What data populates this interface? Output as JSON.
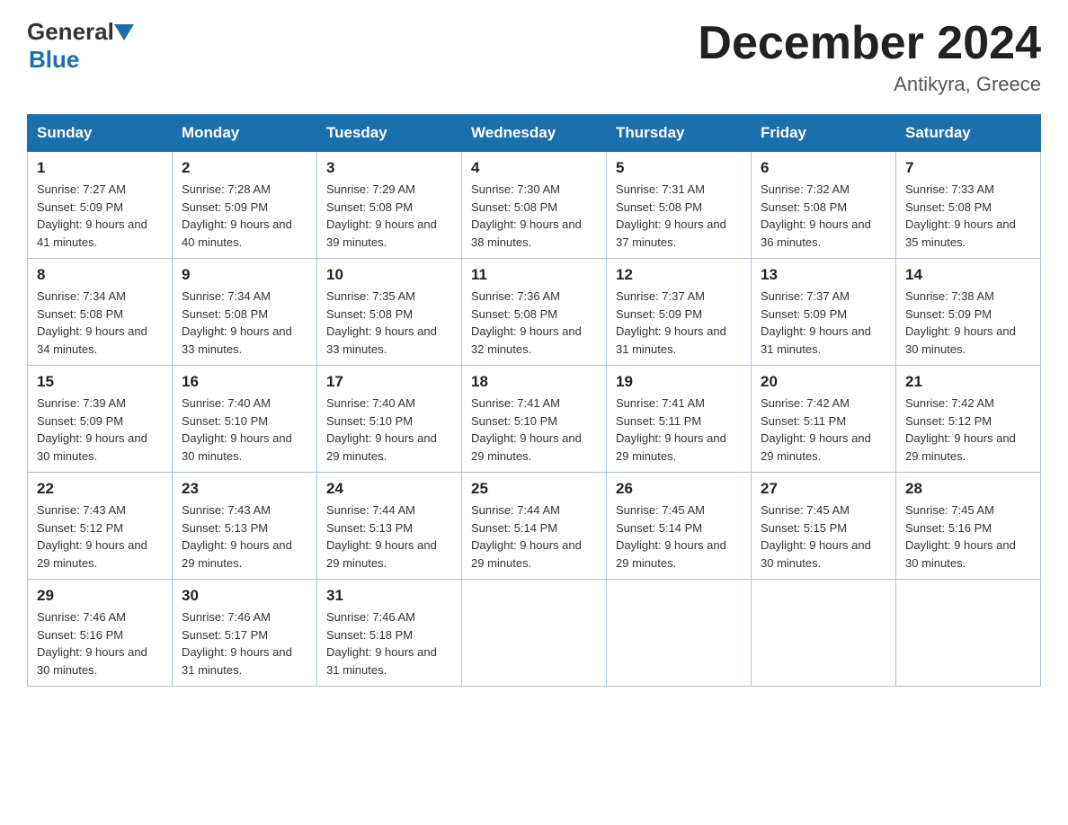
{
  "header": {
    "logo_general": "General",
    "logo_blue": "Blue",
    "month_title": "December 2024",
    "location": "Antikyra, Greece"
  },
  "days_of_week": [
    "Sunday",
    "Monday",
    "Tuesday",
    "Wednesday",
    "Thursday",
    "Friday",
    "Saturday"
  ],
  "weeks": [
    [
      {
        "day": "1",
        "sunrise": "Sunrise: 7:27 AM",
        "sunset": "Sunset: 5:09 PM",
        "daylight": "Daylight: 9 hours and 41 minutes."
      },
      {
        "day": "2",
        "sunrise": "Sunrise: 7:28 AM",
        "sunset": "Sunset: 5:09 PM",
        "daylight": "Daylight: 9 hours and 40 minutes."
      },
      {
        "day": "3",
        "sunrise": "Sunrise: 7:29 AM",
        "sunset": "Sunset: 5:08 PM",
        "daylight": "Daylight: 9 hours and 39 minutes."
      },
      {
        "day": "4",
        "sunrise": "Sunrise: 7:30 AM",
        "sunset": "Sunset: 5:08 PM",
        "daylight": "Daylight: 9 hours and 38 minutes."
      },
      {
        "day": "5",
        "sunrise": "Sunrise: 7:31 AM",
        "sunset": "Sunset: 5:08 PM",
        "daylight": "Daylight: 9 hours and 37 minutes."
      },
      {
        "day": "6",
        "sunrise": "Sunrise: 7:32 AM",
        "sunset": "Sunset: 5:08 PM",
        "daylight": "Daylight: 9 hours and 36 minutes."
      },
      {
        "day": "7",
        "sunrise": "Sunrise: 7:33 AM",
        "sunset": "Sunset: 5:08 PM",
        "daylight": "Daylight: 9 hours and 35 minutes."
      }
    ],
    [
      {
        "day": "8",
        "sunrise": "Sunrise: 7:34 AM",
        "sunset": "Sunset: 5:08 PM",
        "daylight": "Daylight: 9 hours and 34 minutes."
      },
      {
        "day": "9",
        "sunrise": "Sunrise: 7:34 AM",
        "sunset": "Sunset: 5:08 PM",
        "daylight": "Daylight: 9 hours and 33 minutes."
      },
      {
        "day": "10",
        "sunrise": "Sunrise: 7:35 AM",
        "sunset": "Sunset: 5:08 PM",
        "daylight": "Daylight: 9 hours and 33 minutes."
      },
      {
        "day": "11",
        "sunrise": "Sunrise: 7:36 AM",
        "sunset": "Sunset: 5:08 PM",
        "daylight": "Daylight: 9 hours and 32 minutes."
      },
      {
        "day": "12",
        "sunrise": "Sunrise: 7:37 AM",
        "sunset": "Sunset: 5:09 PM",
        "daylight": "Daylight: 9 hours and 31 minutes."
      },
      {
        "day": "13",
        "sunrise": "Sunrise: 7:37 AM",
        "sunset": "Sunset: 5:09 PM",
        "daylight": "Daylight: 9 hours and 31 minutes."
      },
      {
        "day": "14",
        "sunrise": "Sunrise: 7:38 AM",
        "sunset": "Sunset: 5:09 PM",
        "daylight": "Daylight: 9 hours and 30 minutes."
      }
    ],
    [
      {
        "day": "15",
        "sunrise": "Sunrise: 7:39 AM",
        "sunset": "Sunset: 5:09 PM",
        "daylight": "Daylight: 9 hours and 30 minutes."
      },
      {
        "day": "16",
        "sunrise": "Sunrise: 7:40 AM",
        "sunset": "Sunset: 5:10 PM",
        "daylight": "Daylight: 9 hours and 30 minutes."
      },
      {
        "day": "17",
        "sunrise": "Sunrise: 7:40 AM",
        "sunset": "Sunset: 5:10 PM",
        "daylight": "Daylight: 9 hours and 29 minutes."
      },
      {
        "day": "18",
        "sunrise": "Sunrise: 7:41 AM",
        "sunset": "Sunset: 5:10 PM",
        "daylight": "Daylight: 9 hours and 29 minutes."
      },
      {
        "day": "19",
        "sunrise": "Sunrise: 7:41 AM",
        "sunset": "Sunset: 5:11 PM",
        "daylight": "Daylight: 9 hours and 29 minutes."
      },
      {
        "day": "20",
        "sunrise": "Sunrise: 7:42 AM",
        "sunset": "Sunset: 5:11 PM",
        "daylight": "Daylight: 9 hours and 29 minutes."
      },
      {
        "day": "21",
        "sunrise": "Sunrise: 7:42 AM",
        "sunset": "Sunset: 5:12 PM",
        "daylight": "Daylight: 9 hours and 29 minutes."
      }
    ],
    [
      {
        "day": "22",
        "sunrise": "Sunrise: 7:43 AM",
        "sunset": "Sunset: 5:12 PM",
        "daylight": "Daylight: 9 hours and 29 minutes."
      },
      {
        "day": "23",
        "sunrise": "Sunrise: 7:43 AM",
        "sunset": "Sunset: 5:13 PM",
        "daylight": "Daylight: 9 hours and 29 minutes."
      },
      {
        "day": "24",
        "sunrise": "Sunrise: 7:44 AM",
        "sunset": "Sunset: 5:13 PM",
        "daylight": "Daylight: 9 hours and 29 minutes."
      },
      {
        "day": "25",
        "sunrise": "Sunrise: 7:44 AM",
        "sunset": "Sunset: 5:14 PM",
        "daylight": "Daylight: 9 hours and 29 minutes."
      },
      {
        "day": "26",
        "sunrise": "Sunrise: 7:45 AM",
        "sunset": "Sunset: 5:14 PM",
        "daylight": "Daylight: 9 hours and 29 minutes."
      },
      {
        "day": "27",
        "sunrise": "Sunrise: 7:45 AM",
        "sunset": "Sunset: 5:15 PM",
        "daylight": "Daylight: 9 hours and 30 minutes."
      },
      {
        "day": "28",
        "sunrise": "Sunrise: 7:45 AM",
        "sunset": "Sunset: 5:16 PM",
        "daylight": "Daylight: 9 hours and 30 minutes."
      }
    ],
    [
      {
        "day": "29",
        "sunrise": "Sunrise: 7:46 AM",
        "sunset": "Sunset: 5:16 PM",
        "daylight": "Daylight: 9 hours and 30 minutes."
      },
      {
        "day": "30",
        "sunrise": "Sunrise: 7:46 AM",
        "sunset": "Sunset: 5:17 PM",
        "daylight": "Daylight: 9 hours and 31 minutes."
      },
      {
        "day": "31",
        "sunrise": "Sunrise: 7:46 AM",
        "sunset": "Sunset: 5:18 PM",
        "daylight": "Daylight: 9 hours and 31 minutes."
      },
      null,
      null,
      null,
      null
    ]
  ]
}
